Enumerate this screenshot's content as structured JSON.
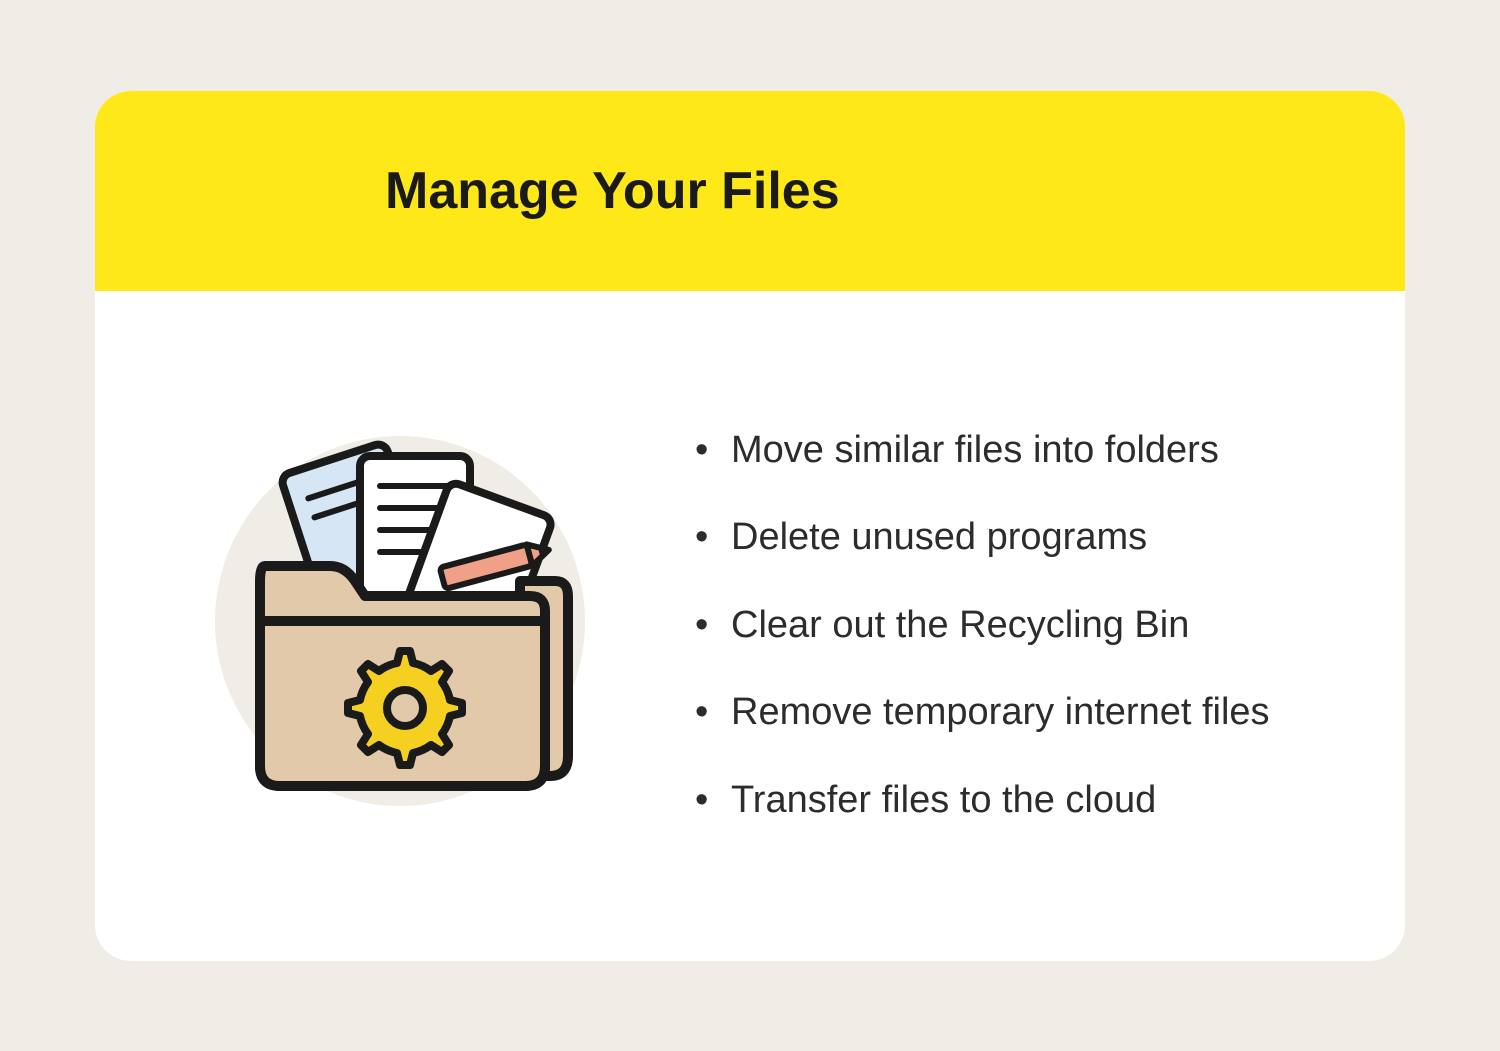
{
  "card": {
    "title": "Manage Your Files",
    "tips": [
      "Move similar files into folders",
      "Delete unused programs",
      "Clear out the Recycling Bin",
      "Remove temporary internet files",
      "Transfer files to the cloud"
    ]
  },
  "colors": {
    "page_bg": "#f0ece6",
    "card_bg": "#ffffff",
    "header_bg": "#ffe817",
    "text": "#1a1a1a",
    "folder_fill": "#e1c9aa",
    "gear_fill": "#f6d020",
    "pencil_fill": "#f0a086",
    "paper_blue": "#d6e6f5",
    "stroke": "#1a1a1a"
  },
  "icon_name": "folder-gear-documents-icon"
}
